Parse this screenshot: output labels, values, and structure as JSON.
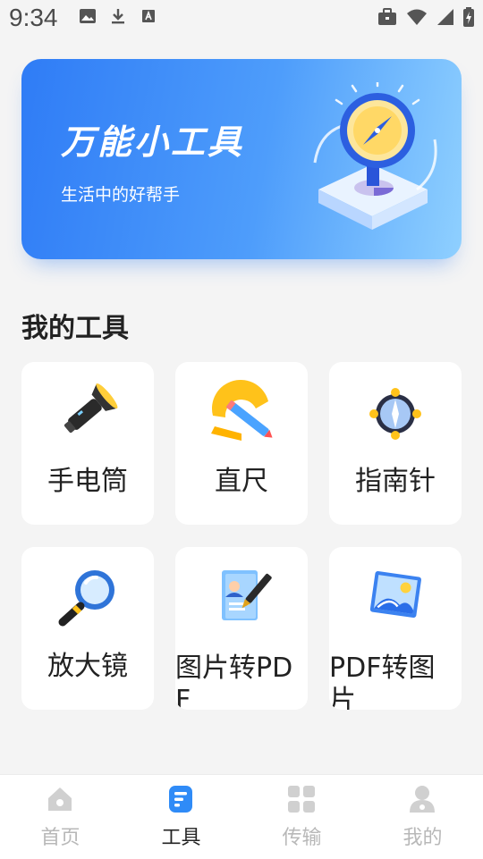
{
  "status_bar": {
    "time": "9:34",
    "left_icons": [
      "image-icon",
      "download-icon",
      "text-icon"
    ],
    "right_icons": [
      "briefcase-icon",
      "wifi-icon",
      "signal-icon",
      "battery-icon"
    ]
  },
  "banner": {
    "title": "万能小工具",
    "subtitle": "生活中的好帮手",
    "art_icon": "compass-illustration-icon"
  },
  "section": {
    "title": "我的工具"
  },
  "tools": [
    {
      "label": "手电筒",
      "icon": "flashlight-icon"
    },
    {
      "label": "直尺",
      "icon": "ruler-icon"
    },
    {
      "label": "指南针",
      "icon": "compass-icon"
    },
    {
      "label": "放大镜",
      "icon": "magnifier-icon"
    },
    {
      "label": "图片转PDF",
      "icon": "image-to-pdf-icon"
    },
    {
      "label": "PDF转图片",
      "icon": "pdf-to-image-icon"
    }
  ],
  "tab_bar": {
    "active": "工具",
    "tabs": [
      {
        "label": "首页",
        "icon": "home-icon"
      },
      {
        "label": "工具",
        "icon": "tools-icon"
      },
      {
        "label": "传输",
        "icon": "grid-icon"
      },
      {
        "label": "我的",
        "icon": "user-icon"
      }
    ]
  },
  "colors": {
    "accent": "#2f7cf6",
    "tab_inactive": "#b8b8b8",
    "tab_active": "#222222",
    "background": "#f4f4f4"
  }
}
